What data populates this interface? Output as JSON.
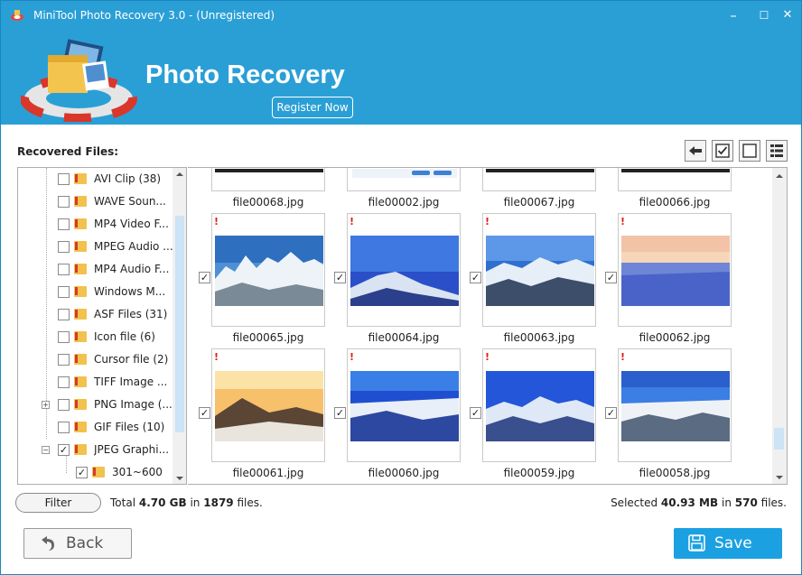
{
  "window": {
    "title": "MiniTool Photo Recovery 3.0 - (Unregistered)",
    "minimize": "–",
    "maximize": "☐",
    "close": "✕"
  },
  "header": {
    "brand_title": "Photo Recovery",
    "register_label": "Register Now"
  },
  "content": {
    "recovered_label": "Recovered Files:"
  },
  "tree": {
    "items": [
      {
        "label": "AVI Clip (38)",
        "checked": false
      },
      {
        "label": "WAVE Soun...",
        "checked": false
      },
      {
        "label": "MP4 Video F...",
        "checked": false
      },
      {
        "label": "MPEG Audio ...",
        "checked": false
      },
      {
        "label": "MP4 Audio F...",
        "checked": false
      },
      {
        "label": "Windows M...",
        "checked": false
      },
      {
        "label": "ASF Files (31)",
        "checked": false
      },
      {
        "label": "Icon file (6)",
        "checked": false
      },
      {
        "label": "Cursor file (2)",
        "checked": false
      },
      {
        "label": "TIFF Image ...",
        "checked": false
      },
      {
        "label": "PNG Image (...",
        "checked": false
      },
      {
        "label": "GIF Files (10)",
        "checked": false
      },
      {
        "label": "JPEG Graphi...",
        "checked": true
      },
      {
        "label": "301~600",
        "checked": true
      }
    ]
  },
  "grid": {
    "top_row": [
      "file00068.jpg",
      "file00002.jpg",
      "file00067.jpg",
      "file00066.jpg"
    ],
    "middle_row": [
      "file00065.jpg",
      "file00064.jpg",
      "file00063.jpg",
      "file00062.jpg"
    ],
    "bottom_row": [
      "file00061.jpg",
      "file00060.jpg",
      "file00059.jpg",
      "file00058.jpg"
    ],
    "warning_mark": "!",
    "check_mark": "✓"
  },
  "status": {
    "filter_label": "Filter",
    "total_prefix": "Total",
    "total_size": "4.70 GB",
    "total_in": "in",
    "total_files": "1879",
    "total_suffix": "files.",
    "selected_prefix": "Selected",
    "selected_size": "40.93 MB",
    "selected_in": "in",
    "selected_files": "570",
    "selected_suffix": "files."
  },
  "actions": {
    "back_label": "Back",
    "save_label": "Save"
  },
  "colors": {
    "header_bg": "#2a9fd6",
    "save_bg": "#1ba1e2",
    "warning": "#e0201a"
  }
}
